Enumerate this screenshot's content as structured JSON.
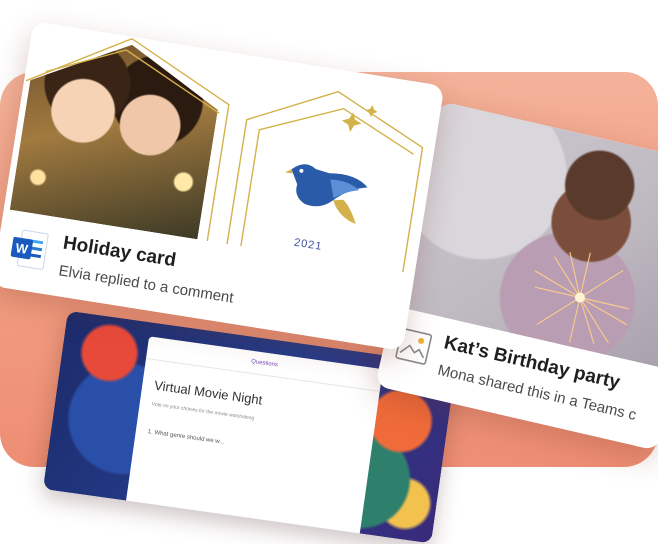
{
  "holiday_card": {
    "title": "Holiday card",
    "subtitle": "Elvia replied to a comment",
    "year_text": "2021",
    "icon": "word-icon"
  },
  "birthday_card": {
    "title": "Kat’s Birthday party",
    "subtitle": "Mona shared this in a Teams c",
    "icon": "image-icon"
  },
  "forms_card": {
    "header": "Questions",
    "title": "Virtual Movie Night",
    "description": "Vote on your choices for the movie watchalong",
    "question": "1. What genre should we w..."
  },
  "colors": {
    "background": "#f19c80",
    "word_blue": "#185abd",
    "gold": "#d4b14a",
    "bird_blue": "#2a5ba8"
  }
}
